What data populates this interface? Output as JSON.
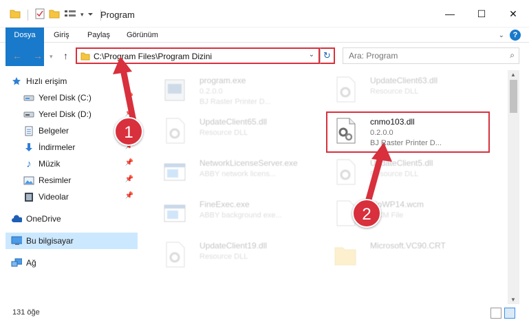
{
  "window": {
    "title": "Program",
    "controls": {
      "minimize": "—",
      "maximize": "☐",
      "close": "✕"
    }
  },
  "ribbon": {
    "tabs": [
      "Dosya",
      "Giriş",
      "Paylaş",
      "Görünüm"
    ],
    "accent": "#1979ca"
  },
  "address": {
    "path": "C:\\Program Files\\Program Dizini",
    "search_placeholder": "Ara: Program"
  },
  "sidebar": {
    "items": [
      {
        "label": "Hızlı erişim",
        "icon": "star-icon",
        "pinned": false
      },
      {
        "label": "Yerel Disk (C:)",
        "icon": "drive-icon",
        "pinned": true
      },
      {
        "label": "Yerel Disk (D:)",
        "icon": "drive-icon",
        "pinned": true
      },
      {
        "label": "Belgeler",
        "icon": "document-icon",
        "pinned": true
      },
      {
        "label": "İndirmeler",
        "icon": "download-icon",
        "pinned": true
      },
      {
        "label": "Müzik",
        "icon": "music-icon",
        "pinned": true
      },
      {
        "label": "Resimler",
        "icon": "pictures-icon",
        "pinned": true
      },
      {
        "label": "Videolar",
        "icon": "video-icon",
        "pinned": true
      },
      {
        "label": "OneDrive",
        "icon": "cloud-icon",
        "pinned": false
      },
      {
        "label": "Bu bilgisayar",
        "icon": "computer-icon",
        "pinned": false
      },
      {
        "label": "Ağ",
        "icon": "network-icon",
        "pinned": false
      }
    ]
  },
  "files": [
    {
      "name": "program.exe",
      "line2": "0.2.0.0",
      "line3": "BJ Raster Printer D...",
      "icon": "exe-icon"
    },
    {
      "name": "UpdateClient63.dll",
      "line2": "Resource DLL",
      "line3": "",
      "icon": "dll-icon"
    },
    {
      "name": "UpdateClient65.dll",
      "line2": "Resource DLL",
      "line3": "",
      "icon": "dll-icon"
    },
    {
      "name": "cnmo103.dll",
      "line2": "0.2.0.0",
      "line3": "BJ Raster Printer D...",
      "icon": "dll-gear-icon"
    },
    {
      "name": "NetworkLicenseServer.exe",
      "line2": "ABBY network licens...",
      "line3": "",
      "icon": "window-icon"
    },
    {
      "name": "UpdateClient5.dll",
      "line2": "Resource DLL",
      "line3": "",
      "icon": "dll-icon"
    },
    {
      "name": "FineExec.exe",
      "line2": "ABBY background exe...",
      "line3": "",
      "icon": "window-icon"
    },
    {
      "name": "BioWP14.wcm",
      "line2": "WCM File",
      "line3": "",
      "icon": "file-icon"
    },
    {
      "name": "UpdateClient19.dll",
      "line2": "Resource DLL",
      "line3": "",
      "icon": "dll-icon"
    },
    {
      "name": "Microsoft.VC90.CRT",
      "line2": "",
      "line3": "",
      "icon": "folder-icon"
    }
  ],
  "status": {
    "count": "131 öğe"
  },
  "annotations": {
    "step1": "1",
    "step2": "2",
    "color": "#d8303c"
  }
}
